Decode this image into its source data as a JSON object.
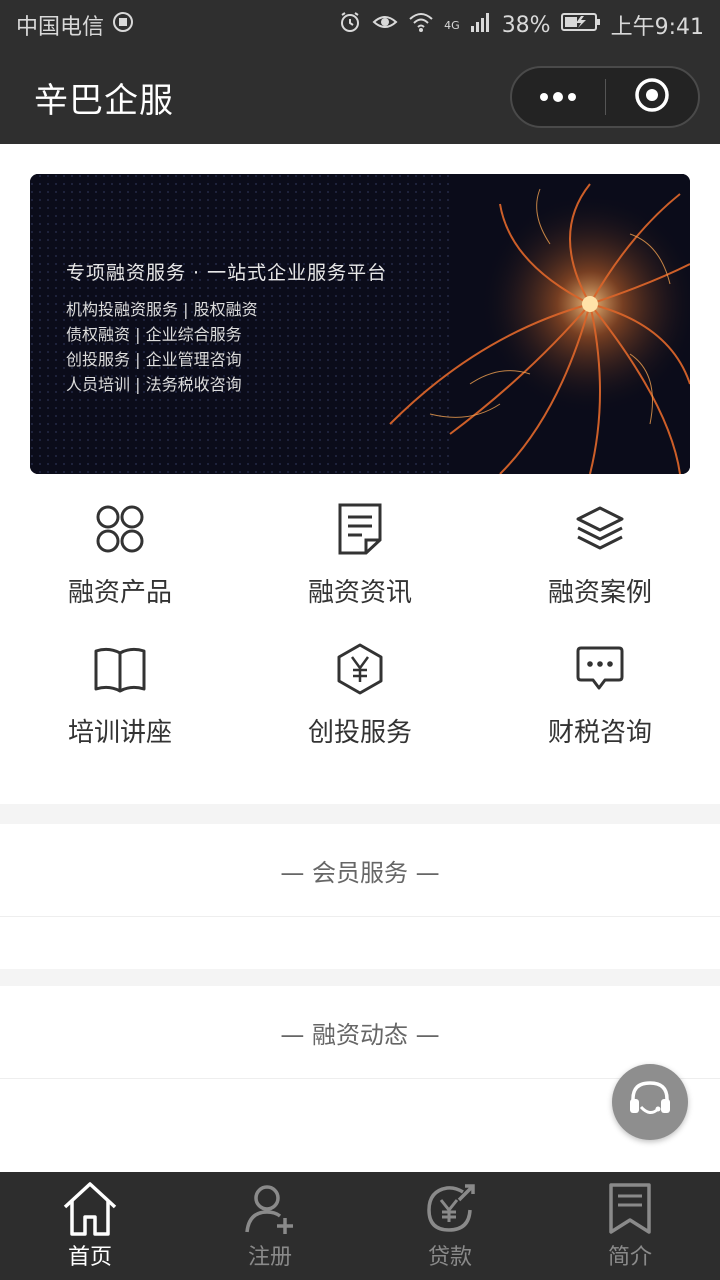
{
  "status_bar": {
    "carrier": "中国电信",
    "network": "4G",
    "battery": "38%",
    "time": "上午9:41"
  },
  "header": {
    "title": "辛巴企服"
  },
  "banner": {
    "headline": "专项融资服务 · 一站式企业服务平台",
    "lines": [
      "机构投融资服务 | 股权融资",
      "债权融资 | 企业综合服务",
      "创投服务 | 企业管理咨询",
      "人员培训 | 法务税收咨询"
    ]
  },
  "grid": [
    {
      "label": "融资产品",
      "icon": "four-circles-icon"
    },
    {
      "label": "融资资讯",
      "icon": "document-icon"
    },
    {
      "label": "融资案例",
      "icon": "layers-icon"
    },
    {
      "label": "培训讲座",
      "icon": "book-icon"
    },
    {
      "label": "创投服务",
      "icon": "yuan-hexagon-icon"
    },
    {
      "label": "财税咨询",
      "icon": "chat-bubble-icon"
    }
  ],
  "sections": {
    "member_services": "— 会员服务 —",
    "financing_news": "— 融资动态 —"
  },
  "tabbar": {
    "items": [
      {
        "label": "首页",
        "icon": "home-icon",
        "active": true
      },
      {
        "label": "注册",
        "icon": "user-add-icon",
        "active": false
      },
      {
        "label": "贷款",
        "icon": "yuan-arrow-icon",
        "active": false
      },
      {
        "label": "简介",
        "icon": "bookmark-icon",
        "active": false
      }
    ]
  },
  "colors": {
    "dark_bar": "#2f2f2f",
    "tab_active": "#ffffff",
    "tab_inactive": "#8a8a8a"
  }
}
